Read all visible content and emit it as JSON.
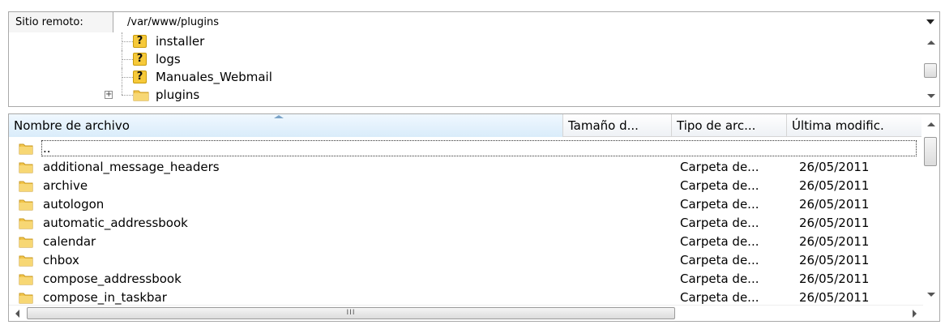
{
  "remote_path": {
    "label": "Sitio remoto:",
    "value": "/var/www/plugins"
  },
  "tree": {
    "items": [
      {
        "label": "installer",
        "icon": "unknown-folder-icon"
      },
      {
        "label": "logs",
        "icon": "unknown-folder-icon"
      },
      {
        "label": "Manuales_Webmail",
        "icon": "unknown-folder-icon"
      },
      {
        "label": "plugins",
        "icon": "folder-icon"
      }
    ],
    "expander": "+"
  },
  "file_list": {
    "columns": [
      "Nombre de archivo",
      "Tamaño d...",
      "Tipo de arc...",
      "Última modific."
    ],
    "rows": [
      {
        "name": "..",
        "type": "",
        "date": ""
      },
      {
        "name": "additional_message_headers",
        "type": "Carpeta de...",
        "date": "26/05/2011"
      },
      {
        "name": "archive",
        "type": "Carpeta de...",
        "date": "26/05/2011"
      },
      {
        "name": "autologon",
        "type": "Carpeta de...",
        "date": "26/05/2011"
      },
      {
        "name": "automatic_addressbook",
        "type": "Carpeta de...",
        "date": "26/05/2011"
      },
      {
        "name": "calendar",
        "type": "Carpeta de...",
        "date": "26/05/2011"
      },
      {
        "name": "chbox",
        "type": "Carpeta de...",
        "date": "26/05/2011"
      },
      {
        "name": "compose_addressbook",
        "type": "Carpeta de...",
        "date": "26/05/2011"
      },
      {
        "name": "compose_in_taskbar",
        "type": "Carpeta de...",
        "date": "26/05/2011"
      }
    ],
    "hscroll_grip": "III"
  },
  "colors": {
    "folder": "#f2c54b",
    "unknown": "#f6c93a",
    "border": "#a9a9a9"
  }
}
